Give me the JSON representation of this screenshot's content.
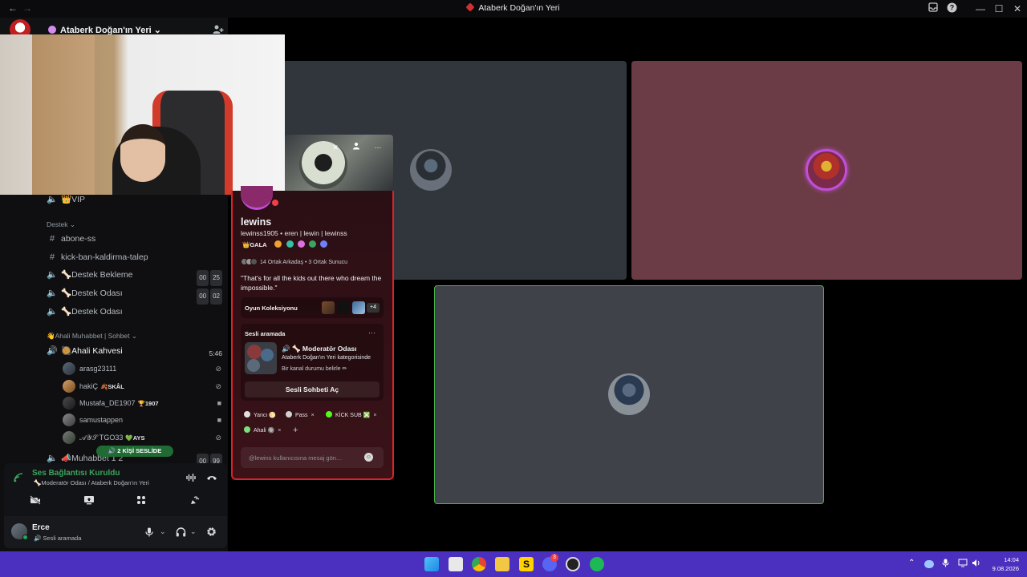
{
  "window": {
    "title": "Ataberk Doğan'ın Yeri",
    "back": "←",
    "forward": "→",
    "inbox_icon": "inbox-icon",
    "help_icon": "help-icon",
    "minimize": "—",
    "maximize": "☐",
    "close": "✕"
  },
  "server": {
    "name": "Ataberk Doğan'ın Yeri",
    "dropdown_caret": "⌄"
  },
  "sidebar": {
    "channels": [
      {
        "label": "👑VIP",
        "icon": "speaker-icon",
        "kind": "voice"
      },
      {
        "label": "Destek",
        "kind": "category"
      },
      {
        "label": "abone-ss",
        "icon": "hash-icon",
        "kind": "text"
      },
      {
        "label": "kick-ban-kaldirma-talep",
        "icon": "hash-icon",
        "kind": "text"
      },
      {
        "label": "🦴Destek Bekleme",
        "icon": "speaker-icon",
        "kind": "voice",
        "count_a": "00",
        "count_b": "25"
      },
      {
        "label": "🦴Destek Odası",
        "icon": "speaker-icon",
        "kind": "voice",
        "count_a": "00",
        "count_b": "02"
      },
      {
        "label": "🦴Destek Odası",
        "icon": "speaker-icon",
        "kind": "voice"
      },
      {
        "label": "👋Ahali Muhabbet | Sohbet",
        "kind": "category"
      },
      {
        "label": "🥘Ahali Kahvesi",
        "icon": "speaker-icon",
        "kind": "voice",
        "timer": "5:46"
      },
      {
        "label": "📣Muhabbet 1 2",
        "icon": "speaker-icon",
        "kind": "voice",
        "count_a": "00",
        "count_b": "99"
      }
    ],
    "voice_users": [
      {
        "name": "arasg23111",
        "tag": "",
        "status": "deafened-icon"
      },
      {
        "name": "hakiÇ",
        "tag": "🍂SKÂL",
        "status": "deafened-icon"
      },
      {
        "name": "Mustafa_DE1907",
        "tag": "🏆1907",
        "status": "camera-icon"
      },
      {
        "name": "samustappen",
        "tag": "",
        "status": "camera-icon"
      },
      {
        "name": "𝒜𝒴𝒮 TGO33",
        "tag": "💚AYS",
        "status": "deafened-icon"
      }
    ],
    "voice_pill": "🔊 2 KİŞİ SESLİDE"
  },
  "voice_connection": {
    "status": "Ses Bağlantısı Kuruldu",
    "channel": "🦴Moderatör Odası / Ataberk Doğan'ın Yeri"
  },
  "user_panel": {
    "name": "Erce",
    "status": "🔊 Sesli aramada"
  },
  "profile": {
    "display_name": "lewins",
    "tagline": "lewinss1905 • eren | lewin | lewinss",
    "guild_tag": "👑GALA",
    "mutual": "14 Ortak Arkadaş • 3 Ortak Sunucu",
    "bio": "\"That's for all the kids out there who dream the impossible.\"",
    "games_label": "Oyun Koleksiyonu",
    "games_more": "+4",
    "voice_label": "Sesli aramada",
    "voice_more": "···",
    "voice_channel": "🔊 🦴 Moderatör Odası",
    "voice_category": "Ataberk Doğan'ın Yeri kategorisinde",
    "voice_status_line": "Bir kanal durumu belirle ✏",
    "voice_button": "Sesli Sohbeti Aç",
    "roles": [
      {
        "label": "Yancı 🌕",
        "color": "#e0e0e0"
      },
      {
        "label": "Pass",
        "color": "#d0d0d0"
      },
      {
        "label": "KİCK SUB ❎",
        "color": "#53fc18"
      },
      {
        "label": "Ahali 🔘",
        "color": "#7ee07a"
      }
    ],
    "role_remove": "×",
    "add_role": "+",
    "message_placeholder": "@lewins kullanıcısına mesaj gön…"
  },
  "taskbar": {
    "time": "14:04",
    "date": "9.08.2026",
    "discord_badge": "3"
  },
  "colors": {
    "accent_red": "#d8232a",
    "online_green": "#23a55a",
    "speaking_border": "#49b44d",
    "taskbar": "#4b2fbf"
  }
}
